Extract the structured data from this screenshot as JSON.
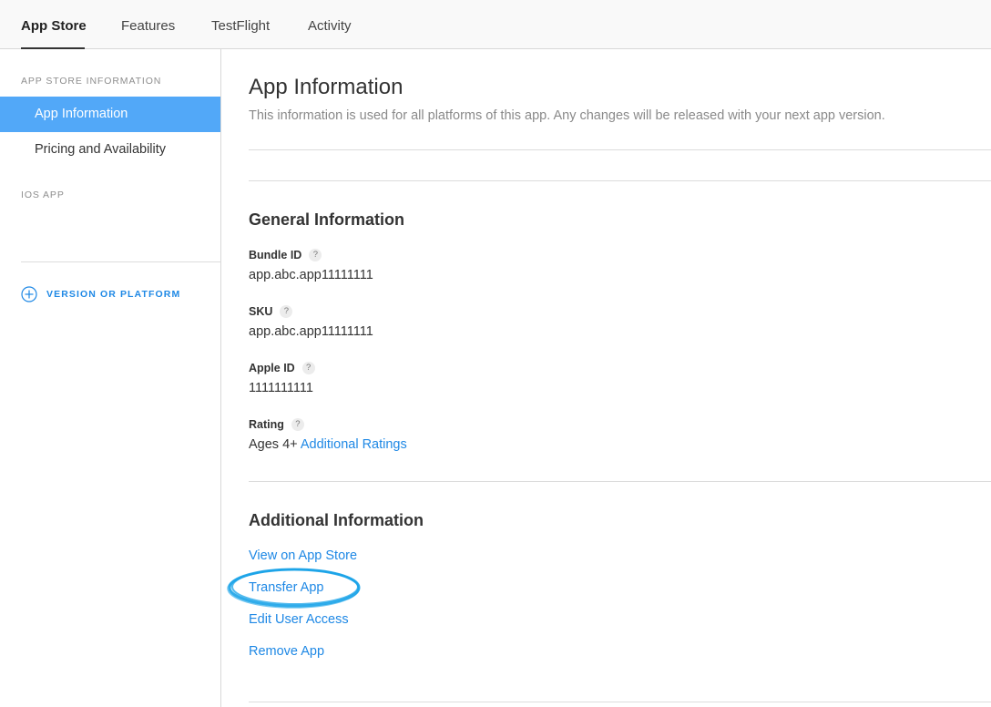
{
  "tabs": [
    {
      "label": "App Store",
      "active": true
    },
    {
      "label": "Features"
    },
    {
      "label": "TestFlight"
    },
    {
      "label": "Activity"
    }
  ],
  "sidebar": {
    "section_app_store": "APP STORE INFORMATION",
    "items": [
      {
        "label": "App Information",
        "active": true
      },
      {
        "label": "Pricing and Availability"
      }
    ],
    "section_ios": "IOS APP",
    "add_version_label": "VERSION OR PLATFORM"
  },
  "main": {
    "title": "App Information",
    "subtitle": "This information is used for all platforms of this app. Any changes will be released with your next app version.",
    "general": {
      "title": "General Information",
      "help_glyph": "?",
      "fields": [
        {
          "label": "Bundle ID",
          "value": "app.abc.app11111111"
        },
        {
          "label": "SKU",
          "value": "app.abc.app11111111"
        },
        {
          "label": "Apple ID",
          "value": "1111111111"
        },
        {
          "label": "Rating",
          "value": "Ages 4+",
          "link": "Additional Ratings"
        }
      ]
    },
    "additional": {
      "title": "Additional Information",
      "links": [
        "View on App Store",
        "Transfer App",
        "Edit User Access",
        "Remove App"
      ]
    }
  },
  "colors": {
    "accent": "#1e88e5",
    "sidebar_active": "#52a8f8",
    "annotation": "#1aa3e8"
  },
  "icons": {
    "add_version": "plus-circle-icon",
    "help": "question-icon"
  }
}
